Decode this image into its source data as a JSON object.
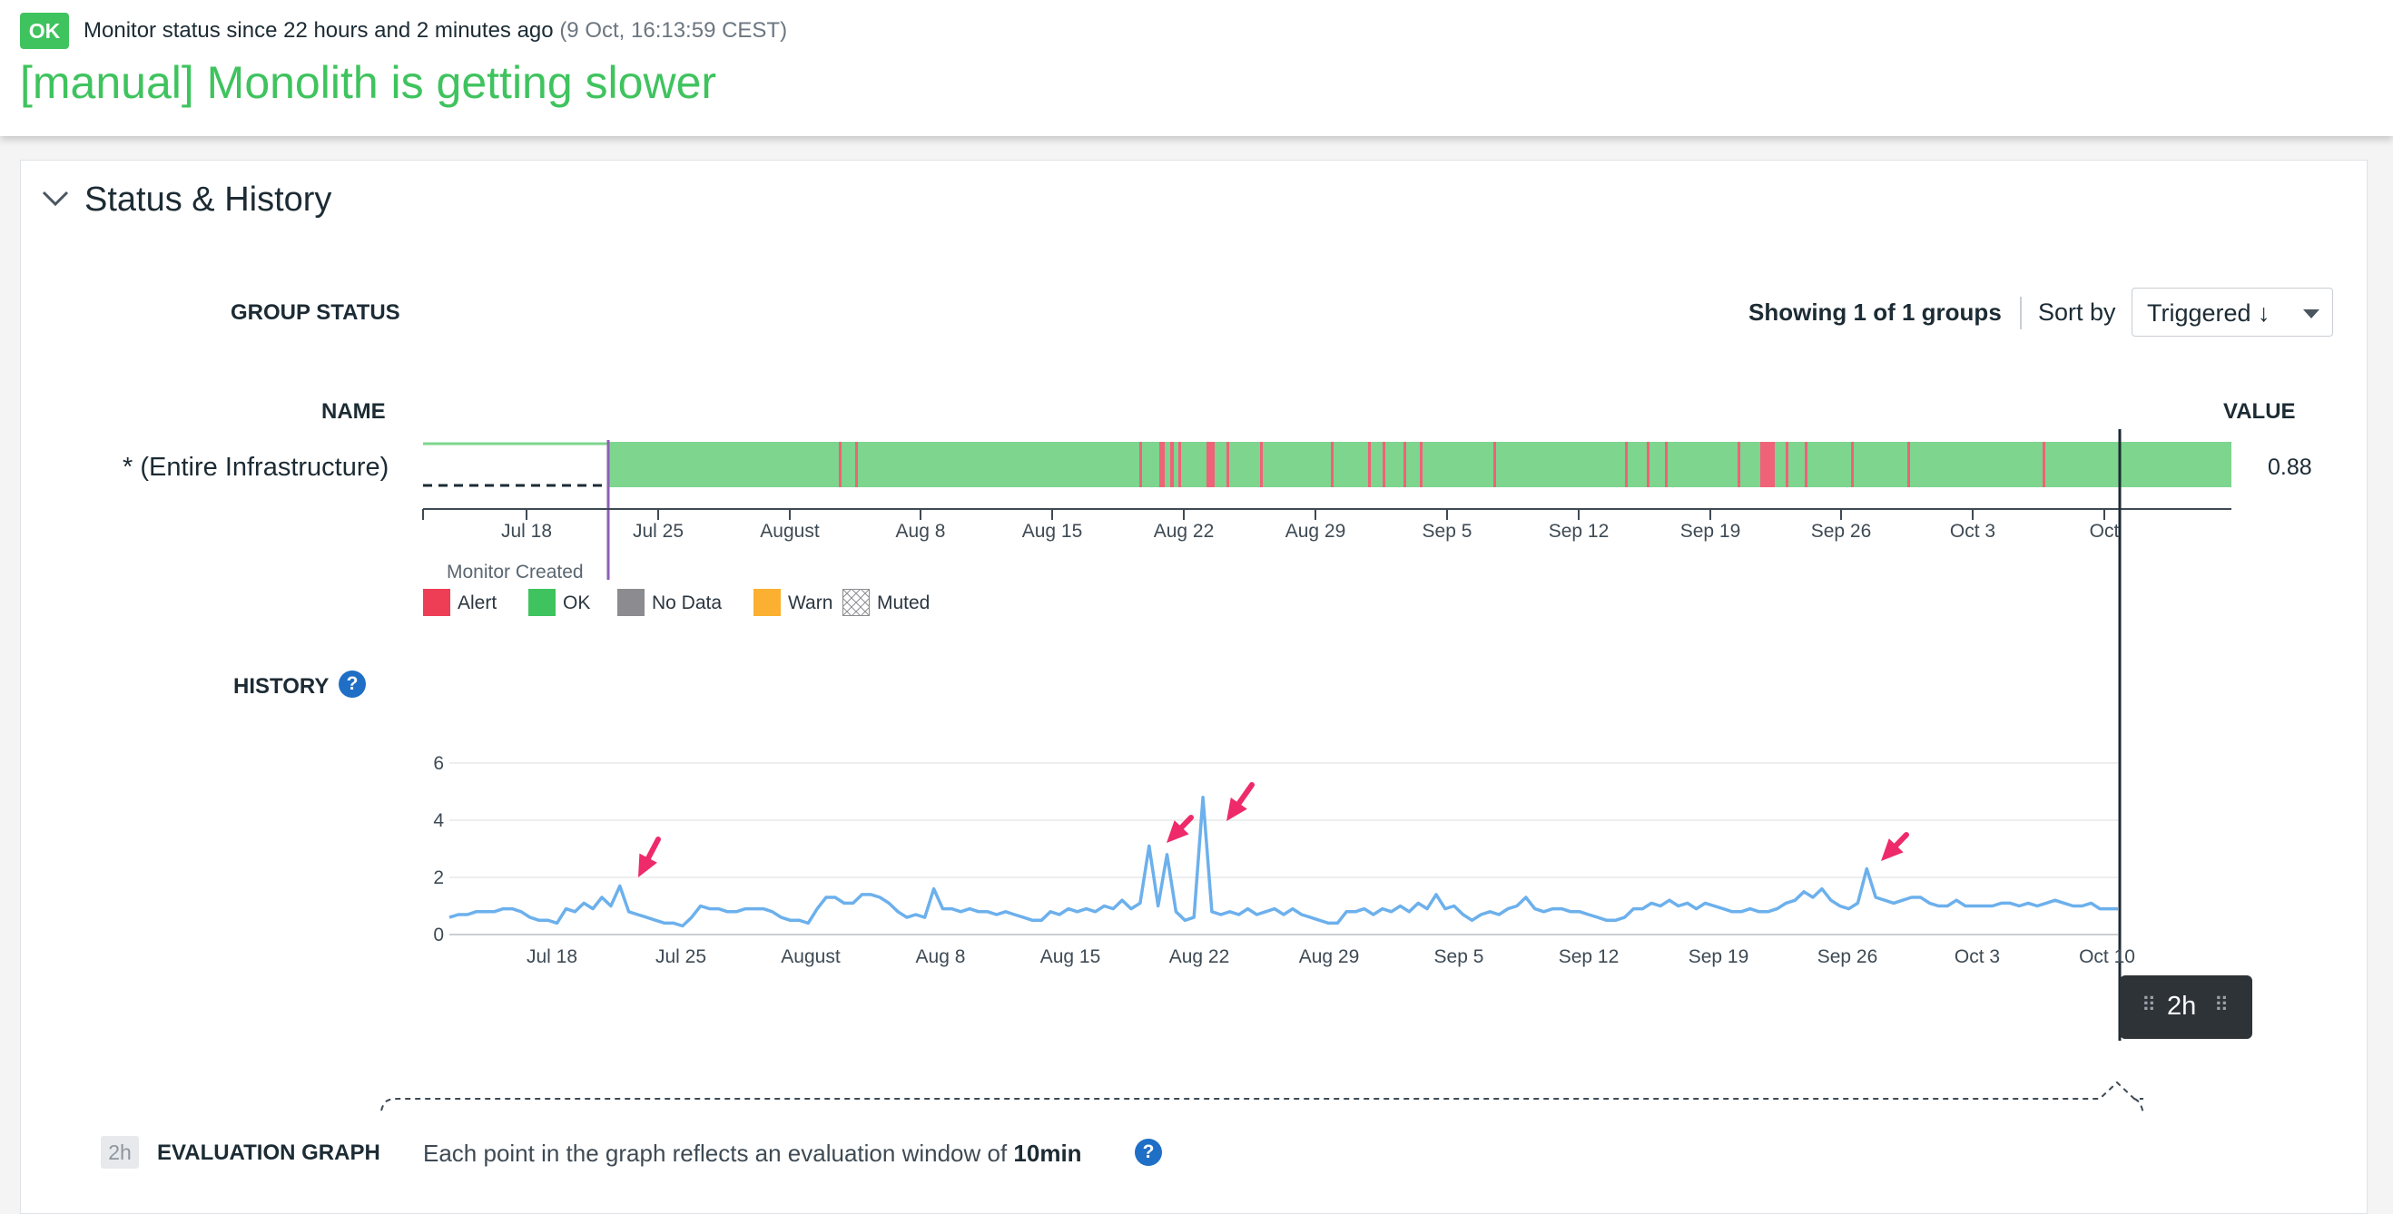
{
  "header": {
    "badge": "OK",
    "status_text": "Monitor status since 22 hours and 2 minutes ago",
    "status_time": "(9 Oct, 16:13:59 CEST)",
    "title": "[manual] Monolith is getting slower"
  },
  "section": {
    "title": "Status & History"
  },
  "group_status": {
    "heading": "GROUP STATUS",
    "showing": "Showing 1 of 1 groups",
    "sort_label": "Sort by",
    "sort_value": "Triggered ↓",
    "name_header": "NAME",
    "value_header": "VALUE",
    "group_name": "* (Entire Infrastructure)",
    "group_value": "0.88",
    "monitor_created": "Monitor Created",
    "timeline_ticks": [
      "Jul 18",
      "Jul 25",
      "August",
      "Aug 8",
      "Aug 15",
      "Aug 22",
      "Aug 29",
      "Sep 5",
      "Sep 12",
      "Sep 19",
      "Sep 26",
      "Oct 3",
      "Oct"
    ],
    "legend": [
      {
        "label": "Alert",
        "color": "#ee3e56"
      },
      {
        "label": "OK",
        "color": "#3fc35e"
      },
      {
        "label": "No Data",
        "color": "#8c8c90"
      },
      {
        "label": "Warn",
        "color": "#fbb031"
      },
      {
        "label": "Muted",
        "color": "hatched"
      }
    ],
    "colors": {
      "ok": "#7dd58e",
      "alert": "#f06278",
      "monitor_line": "#8e5fb6"
    }
  },
  "history": {
    "heading": "HISTORY",
    "help_icon": "?",
    "window_tag": "2h"
  },
  "evaluation": {
    "tag": "2h",
    "heading": "EVALUATION GRAPH",
    "text": "Each point in the graph reflects an evaluation window of",
    "window": "10min",
    "help_icon": "?"
  },
  "chart_data": {
    "type": "line",
    "title": "",
    "xlabel": "",
    "ylabel": "",
    "ylim": [
      0,
      6
    ],
    "yticks": [
      "0",
      "2",
      "4",
      "6"
    ],
    "x_ticks": [
      "Jul 18",
      "Jul 25",
      "August",
      "Aug 8",
      "Aug 15",
      "Aug 22",
      "Aug 29",
      "Sep 5",
      "Sep 12",
      "Sep 19",
      "Sep 26",
      "Oct 3",
      "Oct 10"
    ],
    "grid": true,
    "line_color": "#6cb0ec",
    "series": [
      {
        "values": [
          0.6,
          0.7,
          0.7,
          0.8,
          0.8,
          0.8,
          0.9,
          0.9,
          0.8,
          0.6,
          0.5,
          0.5,
          0.4,
          0.9,
          0.8,
          1.1,
          0.9,
          1.3,
          1.0,
          1.7,
          0.8,
          0.7,
          0.6,
          0.5,
          0.4,
          0.4,
          0.3,
          0.6,
          1.0,
          0.9,
          0.9,
          0.8,
          0.8,
          0.9,
          0.9,
          0.9,
          0.8,
          0.6,
          0.5,
          0.5,
          0.4,
          0.9,
          1.3,
          1.3,
          1.1,
          1.1,
          1.4,
          1.4,
          1.3,
          1.1,
          0.8,
          0.6,
          0.7,
          0.6,
          1.6,
          0.9,
          0.9,
          0.8,
          0.9,
          0.8,
          0.8,
          0.7,
          0.8,
          0.7,
          0.6,
          0.5,
          0.5,
          0.8,
          0.7,
          0.9,
          0.8,
          0.9,
          0.8,
          1.0,
          0.9,
          1.2,
          0.9,
          1.1,
          3.1,
          1.0,
          2.8,
          0.8,
          0.5,
          0.6,
          4.8,
          0.8,
          0.7,
          0.8,
          0.7,
          0.9,
          0.7,
          0.8,
          0.9,
          0.7,
          0.9,
          0.7,
          0.6,
          0.5,
          0.4,
          0.4,
          0.8,
          0.8,
          0.9,
          0.7,
          0.9,
          0.8,
          1.0,
          0.8,
          1.1,
          0.9,
          1.4,
          0.9,
          1.0,
          0.7,
          0.5,
          0.7,
          0.8,
          0.7,
          0.9,
          1.0,
          1.3,
          0.9,
          0.8,
          0.9,
          0.9,
          0.8,
          0.8,
          0.7,
          0.6,
          0.5,
          0.5,
          0.6,
          0.9,
          0.9,
          1.1,
          1.0,
          1.2,
          1.0,
          1.1,
          0.9,
          1.1,
          1.0,
          0.9,
          0.8,
          0.8,
          0.9,
          0.8,
          0.8,
          0.9,
          1.1,
          1.2,
          1.5,
          1.3,
          1.6,
          1.2,
          1.0,
          0.9,
          1.1,
          2.3,
          1.3,
          1.2,
          1.1,
          1.2,
          1.3,
          1.3,
          1.1,
          1.0,
          1.0,
          1.2,
          1.0,
          1.0,
          1.0,
          1.0,
          1.1,
          1.1,
          1.0,
          1.1,
          1.0,
          1.1,
          1.2,
          1.1,
          1.0,
          1.0,
          1.1,
          0.9,
          0.9,
          0.9
        ]
      }
    ],
    "annotations": [
      "arrow",
      "arrow",
      "arrow",
      "arrow"
    ]
  }
}
